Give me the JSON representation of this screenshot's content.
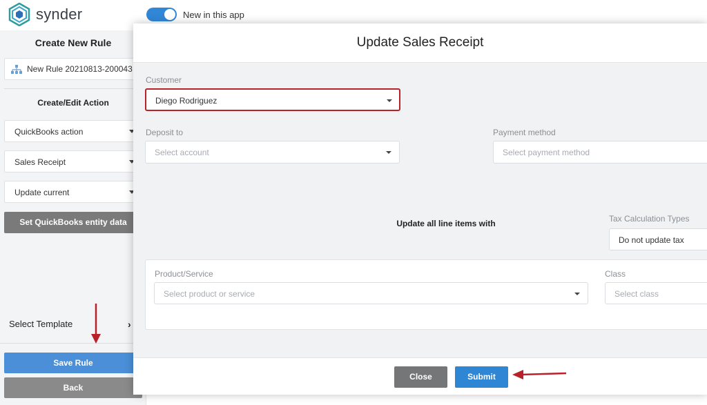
{
  "app": {
    "brand": "synder",
    "new_toggle_label": "New in this app",
    "new_toggle_on": true,
    "colors": {
      "accent": "#3186d6",
      "highlight_border": "#b8202a",
      "annotation_arrow": "#b8202a"
    }
  },
  "sidebar": {
    "title": "Create New Rule",
    "rule_name": "New Rule 20210813-200043",
    "section_title": "Create/Edit Action",
    "selects": [
      {
        "value": "QuickBooks action"
      },
      {
        "value": "Sales Receipt"
      },
      {
        "value": "Update current"
      }
    ],
    "set_entity_button": "Set QuickBooks entity data",
    "select_template": "Select Template",
    "save_button": "Save Rule",
    "back_button": "Back"
  },
  "modal": {
    "title": "Update Sales Receipt",
    "customer": {
      "label": "Customer",
      "value": "Diego Rodriguez"
    },
    "deposit_to": {
      "label": "Deposit to",
      "placeholder": "Select account"
    },
    "payment_method": {
      "label": "Payment method",
      "placeholder": "Select payment method"
    },
    "line_items_title": "Update all line items with",
    "tax_calc": {
      "label": "Tax Calculation Types",
      "value": "Do not update tax"
    },
    "product": {
      "label": "Product/Service",
      "placeholder": "Select product or service"
    },
    "class": {
      "label": "Class",
      "placeholder": "Select class"
    },
    "close_button": "Close",
    "submit_button": "Submit"
  }
}
